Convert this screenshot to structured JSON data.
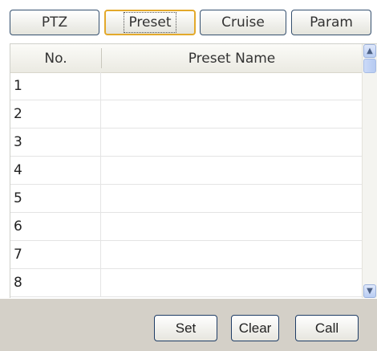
{
  "tabs": [
    {
      "label": "PTZ",
      "selected": false
    },
    {
      "label": "Preset",
      "selected": true
    },
    {
      "label": "Cruise",
      "selected": false
    },
    {
      "label": "Param",
      "selected": false
    }
  ],
  "table": {
    "columns": [
      "No.",
      "Preset Name"
    ],
    "rows": [
      {
        "no": "1",
        "name": ""
      },
      {
        "no": "2",
        "name": ""
      },
      {
        "no": "3",
        "name": ""
      },
      {
        "no": "4",
        "name": ""
      },
      {
        "no": "5",
        "name": ""
      },
      {
        "no": "6",
        "name": ""
      },
      {
        "no": "7",
        "name": ""
      },
      {
        "no": "8",
        "name": ""
      }
    ]
  },
  "scrollbar": {
    "up_icon": "chevron-up-icon",
    "down_icon": "chevron-down-icon"
  },
  "buttons": {
    "set": "Set",
    "clear": "Clear",
    "call": "Call"
  },
  "colors": {
    "selected_tab_border": "#e3a92b",
    "footer_bg": "#d4d0c8",
    "button_border": "#1f3d66"
  }
}
